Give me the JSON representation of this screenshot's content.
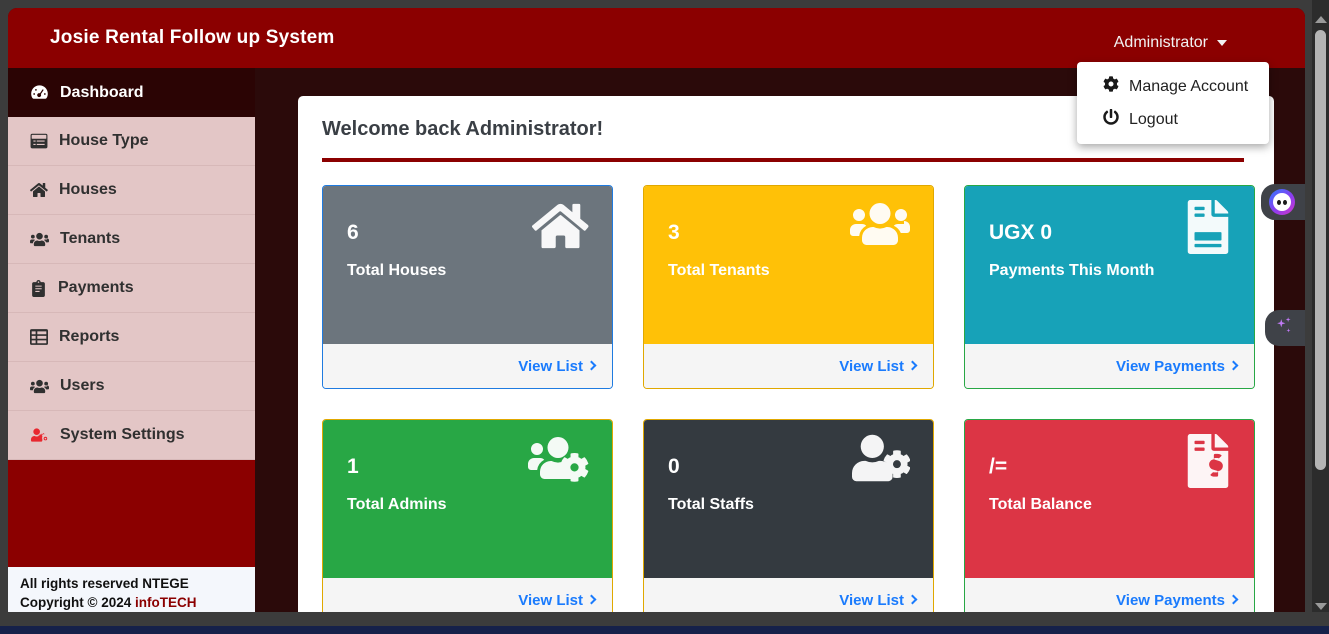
{
  "header": {
    "brand_title": "Josie Rental Follow up System",
    "user_label": "Administrator",
    "caret_icon": "chevron-down-icon"
  },
  "user_dropdown": {
    "items": [
      {
        "label": "Manage Account",
        "icon": "gear-icon"
      },
      {
        "label": "Logout",
        "icon": "power-icon"
      }
    ]
  },
  "sidebar": {
    "items": [
      {
        "label": "Dashboard",
        "icon": "dashboard-icon",
        "active": true
      },
      {
        "label": "House Type",
        "icon": "list-icon",
        "active": false
      },
      {
        "label": "Houses",
        "icon": "home-icon",
        "active": false
      },
      {
        "label": "Tenants",
        "icon": "users-icon",
        "active": false
      },
      {
        "label": "Payments",
        "icon": "receipt-icon",
        "active": false
      },
      {
        "label": "Reports",
        "icon": "table-icon",
        "active": false
      },
      {
        "label": "Users",
        "icon": "user-group-icon",
        "active": false
      },
      {
        "label": "System Settings",
        "icon": "cogs-icon",
        "active": false
      }
    ],
    "footer": {
      "line1": "All rights reserved NTEGE",
      "line2_prefix": "Copyright © 2024 ",
      "line2_brand": "infoTECH"
    }
  },
  "main": {
    "welcome_heading": "Welcome back Administrator!",
    "cards": [
      {
        "value": "6",
        "label": "Total Houses",
        "link": "View List",
        "icon": "home-icon",
        "bg": "#6c757d",
        "border": "#1f7be0"
      },
      {
        "value": "3",
        "label": "Total Tenants",
        "link": "View List",
        "icon": "users-icon",
        "bg": "#ffc107",
        "border": "#e0a800"
      },
      {
        "value": "UGX 0",
        "label": "Payments This Month",
        "link": "View Payments",
        "icon": "file-invoice-icon",
        "bg": "#17a2b8",
        "border": "#28a745"
      },
      {
        "value": "1",
        "label": "Total Admins",
        "link": "View List",
        "icon": "users-cog-icon",
        "bg": "#28a745",
        "border": "#e0a800"
      },
      {
        "value": "0",
        "label": "Total Staffs",
        "link": "View List",
        "icon": "user-cog-icon",
        "bg": "#343a40",
        "border": "#e0a800"
      },
      {
        "value": "/=",
        "label": "Total Balance",
        "link": "View Payments",
        "icon": "file-invoice-dollar-icon",
        "bg": "#dc3545",
        "border": "#28a745"
      }
    ]
  },
  "widgets": [
    {
      "name": "chat-avatar-widget",
      "icon": "ninja-avatar-icon"
    },
    {
      "name": "ai-sparkle-widget",
      "icon": "sparkles-icon"
    }
  ],
  "colors": {
    "brand_dark_red": "#8b0000",
    "sidebar_item_bg": "#e3c6c6",
    "active_item_bg": "#2b0404",
    "link_blue": "#1a7bfd"
  }
}
